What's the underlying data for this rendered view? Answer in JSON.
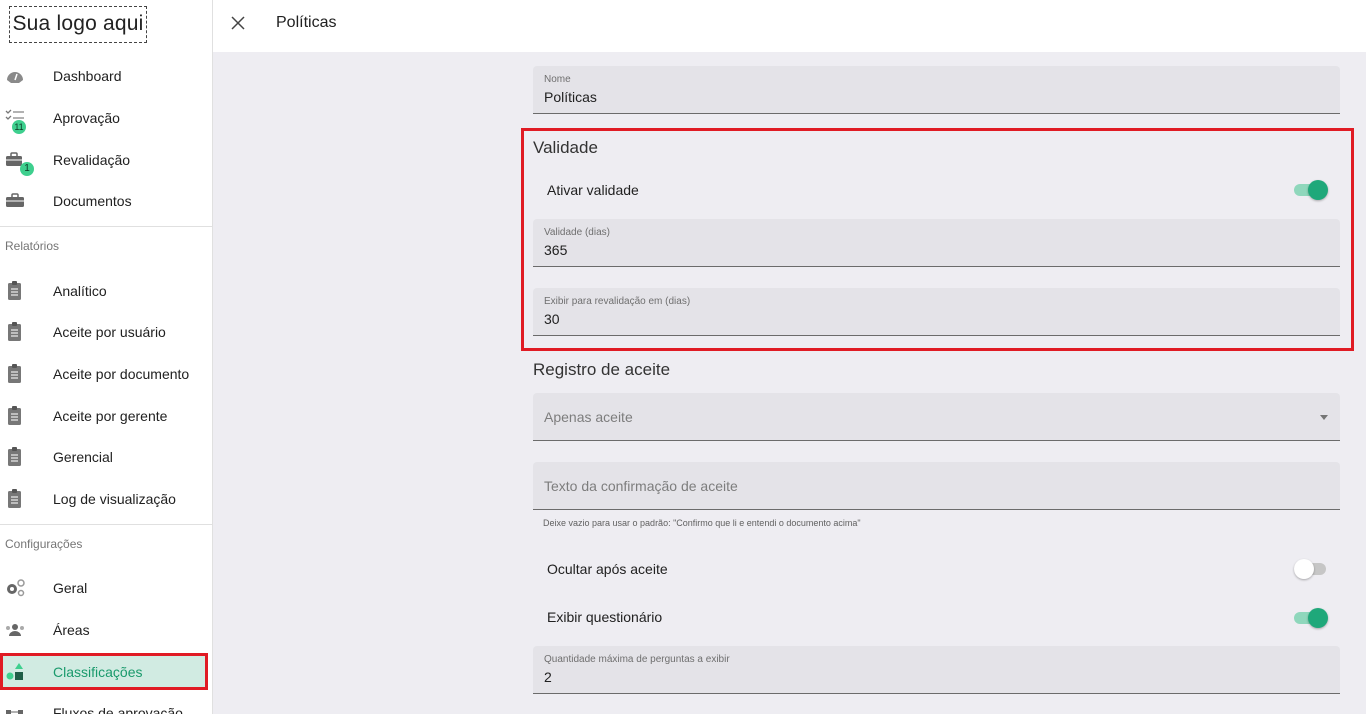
{
  "logo": "Sua logo aqui",
  "nav": {
    "dashboard": "Dashboard",
    "aprovacao": "Aprovação",
    "aprovacao_badge": "11",
    "revalidacao": "Revalidação",
    "revalidacao_badge": "1",
    "documentos": "Documentos"
  },
  "reports": {
    "section": "Relatórios",
    "items": [
      "Analítico",
      "Aceite por usuário",
      "Aceite por documento",
      "Aceite por gerente",
      "Gerencial",
      "Log de visualização"
    ]
  },
  "config": {
    "section": "Configurações",
    "geral": "Geral",
    "areas": "Áreas",
    "classificacoes": "Classificações",
    "fluxos": "Fluxos de aprovação"
  },
  "header": {
    "title": "Políticas"
  },
  "form": {
    "nome_label": "Nome",
    "nome_value": "Políticas",
    "validade_section": "Validade",
    "ativar_validade": "Ativar validade",
    "validade_dias_label": "Validade (dias)",
    "validade_dias_value": "365",
    "exibir_revalidacao_label": "Exibir para revalidação em (dias)",
    "exibir_revalidacao_value": "30",
    "registro_section": "Registro de aceite",
    "registro_select_value": "Apenas aceite",
    "texto_confirmacao_placeholder": "Texto da confirmação de aceite",
    "texto_confirmacao_hint": "Deixe vazio para usar o padrão: \"Confirmo que li e entendi o documento acima\"",
    "ocultar_apos_aceite": "Ocultar após aceite",
    "exibir_questionario": "Exibir questionário",
    "qtd_perguntas_label": "Quantidade máxima de perguntas a exibir",
    "qtd_perguntas_value": "2"
  },
  "toggles": {
    "ativar_validade": true,
    "ocultar_apos_aceite": false,
    "exibir_questionario": true
  },
  "colors": {
    "accent": "#1fa87a",
    "highlight": "#e01b24",
    "active_bg": "#d1ebe2"
  }
}
